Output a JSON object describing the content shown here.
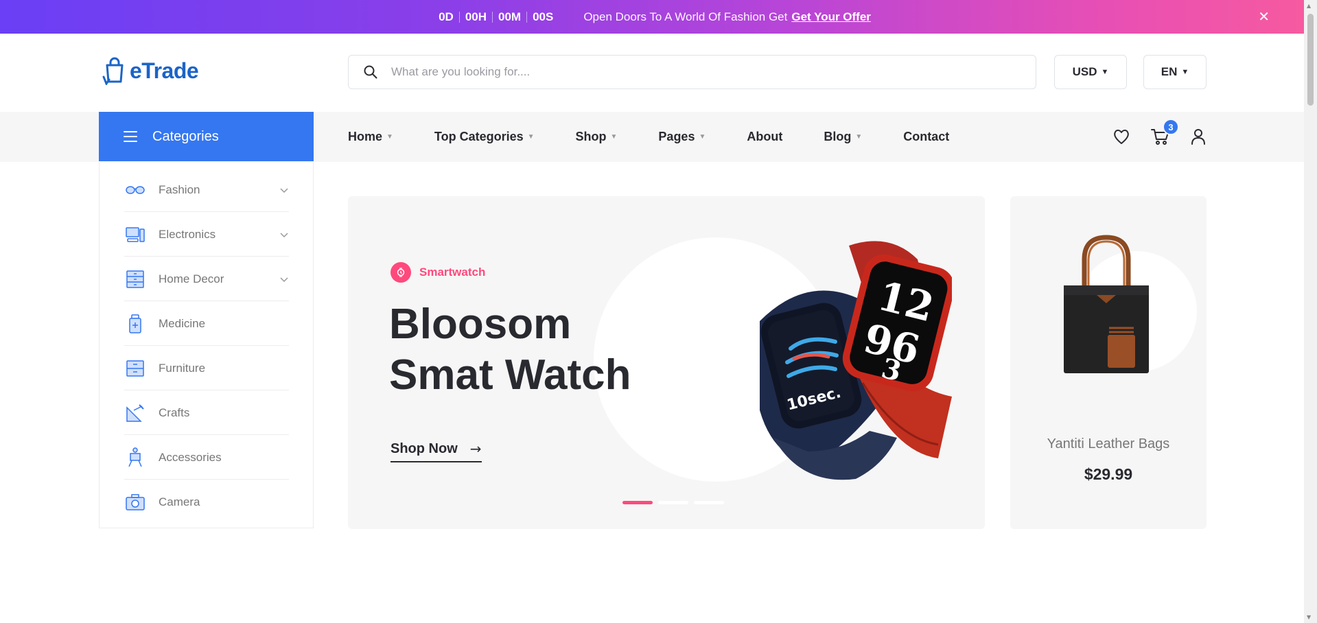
{
  "promo": {
    "countdown": [
      "0D",
      "00H",
      "00M",
      "00S"
    ],
    "text": "Open Doors To A World Of Fashion Get",
    "link": "Get Your Offer",
    "close_glyph": "✕"
  },
  "header": {
    "logo_text": "eTrade",
    "search_placeholder": "What are you looking for....",
    "currency": "USD",
    "language": "EN"
  },
  "navbar": {
    "categories_label": "Categories",
    "items": [
      {
        "label": "Home",
        "dropdown": true
      },
      {
        "label": "Top Categories",
        "dropdown": true
      },
      {
        "label": "Shop",
        "dropdown": true
      },
      {
        "label": "Pages",
        "dropdown": true
      },
      {
        "label": "About",
        "dropdown": false
      },
      {
        "label": "Blog",
        "dropdown": true
      },
      {
        "label": "Contact",
        "dropdown": false
      }
    ],
    "cart_count": "3",
    "icons": [
      "heart-icon",
      "cart-icon",
      "user-icon"
    ]
  },
  "sidebar": {
    "items": [
      {
        "label": "Fashion",
        "icon": "sunglasses-icon",
        "has_submenu": true
      },
      {
        "label": "Electronics",
        "icon": "computer-icon",
        "has_submenu": true
      },
      {
        "label": "Home Decor",
        "icon": "dresser-icon",
        "has_submenu": true
      },
      {
        "label": "Medicine",
        "icon": "medicine-bottle-icon",
        "has_submenu": false
      },
      {
        "label": "Furniture",
        "icon": "cabinet-icon",
        "has_submenu": false
      },
      {
        "label": "Crafts",
        "icon": "crafts-icon",
        "has_submenu": false
      },
      {
        "label": "Accessories",
        "icon": "easel-icon",
        "has_submenu": false
      },
      {
        "label": "Camera",
        "icon": "camera-icon",
        "has_submenu": false
      }
    ]
  },
  "hero": {
    "subtitle": "Smartwatch",
    "title_line1": "Bloosom",
    "title_line2": "Smat Watch",
    "cta": "Shop Now",
    "slides": 3,
    "active_slide": 1
  },
  "side_product": {
    "name": "Yantiti Leather Bags",
    "price": "$29.99"
  },
  "colors": {
    "primary": "#3577f0",
    "accent": "#ff497c",
    "text": "#292930",
    "muted": "#777777",
    "panel": "#f6f6f6"
  }
}
